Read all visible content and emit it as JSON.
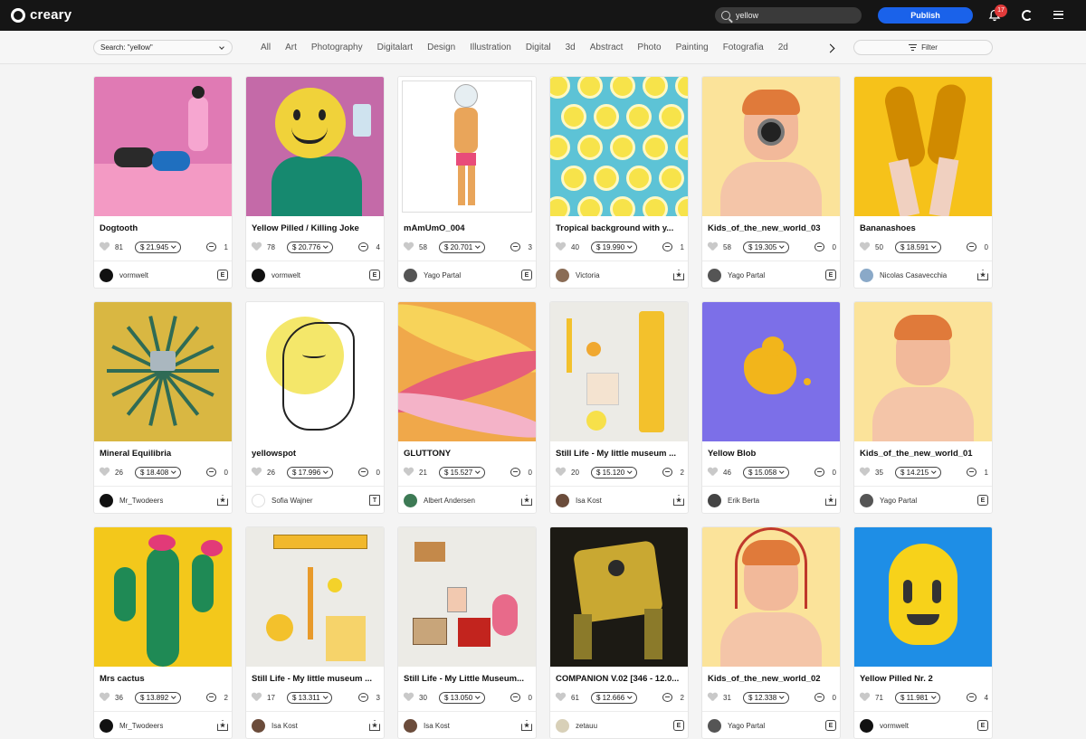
{
  "app": {
    "name": "creary"
  },
  "topbar": {
    "search_value": "yellow",
    "publish_label": "Publish",
    "notification_count": "17"
  },
  "filters": {
    "search_select": "Search: \"yellow\"",
    "filter_label": "Filter",
    "tags": [
      "All",
      "Art",
      "Photography",
      "Digitalart",
      "Design",
      "Illustration",
      "Digital",
      "3d",
      "Abstract",
      "Photo",
      "Painting",
      "Fotografia",
      "2d"
    ]
  },
  "cards": [
    {
      "title": "Dogtooth",
      "likes": "81",
      "price": "$ 21.945",
      "comments": "1",
      "author": "vormwelt",
      "badge": "E",
      "bg": "#e07ab4",
      "accent": "#f4a7c9",
      "avatar": "#111111"
    },
    {
      "title": "Yellow Pilled / Killing Joke",
      "likes": "78",
      "price": "$ 20.776",
      "comments": "4",
      "author": "vormwelt",
      "badge": "E",
      "bg": "#c46aa8",
      "accent": "#f0d23a",
      "avatar": "#111111"
    },
    {
      "title": "mAmUmO_004",
      "likes": "58",
      "price": "$ 20.701",
      "comments": "3",
      "author": "Yago Partal",
      "badge": "E",
      "bg": "#ffffff",
      "accent": "#e9a55a",
      "avatar": "#555555"
    },
    {
      "title": "Tropical background with y...",
      "likes": "40",
      "price": "$ 19.990",
      "comments": "1",
      "author": "Victoria",
      "badge": "H",
      "bg": "#5dc3d6",
      "accent": "#f7e34a",
      "avatar": "#8a6c55"
    },
    {
      "title": "Kids_of_the_new_world_03",
      "likes": "58",
      "price": "$ 19.305",
      "comments": "0",
      "author": "Yago Partal",
      "badge": "E",
      "bg": "#fbe39a",
      "accent": "#f2b99a",
      "avatar": "#555555"
    },
    {
      "title": "Bananashoes",
      "likes": "50",
      "price": "$ 18.591",
      "comments": "0",
      "author": "Nicolas Casavecchia",
      "badge": "H",
      "bg": "#f6c21a",
      "accent": "#e0a800",
      "avatar": "#8aa9c8"
    },
    {
      "title": "Mineral Equilibria",
      "likes": "26",
      "price": "$ 18.408",
      "comments": "0",
      "author": "Mr_Twodeers",
      "badge": "H",
      "bg": "#d9b742",
      "accent": "#2f6b55",
      "avatar": "#111111"
    },
    {
      "title": "yellowspot",
      "likes": "26",
      "price": "$ 17.996",
      "comments": "0",
      "author": "Sofia Wajner",
      "badge": "T",
      "bg": "#ffffff",
      "accent": "#f4e76a",
      "avatar": "#ffffff"
    },
    {
      "title": "GLUTTONY",
      "likes": "21",
      "price": "$ 15.527",
      "comments": "0",
      "author": "Albert Andersen",
      "badge": "H",
      "bg": "#f0a84a",
      "accent": "#e65f7a",
      "avatar": "#3d7a55"
    },
    {
      "title": "Still Life - My little museum ...",
      "likes": "20",
      "price": "$ 15.120",
      "comments": "2",
      "author": "Isa Kost",
      "badge": "H",
      "bg": "#ecebe6",
      "accent": "#f3c12c",
      "avatar": "#6b4c3b"
    },
    {
      "title": "Yellow Blob",
      "likes": "46",
      "price": "$ 15.058",
      "comments": "0",
      "author": "Erik Berta",
      "badge": "H",
      "bg": "#7c6fe8",
      "accent": "#f2b51b",
      "avatar": "#444444"
    },
    {
      "title": "Kids_of_the_new_world_01",
      "likes": "35",
      "price": "$ 14.215",
      "comments": "1",
      "author": "Yago Partal",
      "badge": "E",
      "bg": "#fbe39a",
      "accent": "#f2b99a",
      "avatar": "#555555"
    },
    {
      "title": "Mrs cactus",
      "likes": "36",
      "price": "$ 13.892",
      "comments": "2",
      "author": "Mr_Twodeers",
      "badge": "H",
      "bg": "#f3c81b",
      "accent": "#1f8a55",
      "avatar": "#111111"
    },
    {
      "title": "Still Life - My little museum ...",
      "likes": "17",
      "price": "$ 13.311",
      "comments": "3",
      "author": "Isa Kost",
      "badge": "H",
      "bg": "#ecebe6",
      "accent": "#f3c12c",
      "avatar": "#6b4c3b"
    },
    {
      "title": "Still Life - My Little Museum...",
      "likes": "30",
      "price": "$ 13.050",
      "comments": "0",
      "author": "Isa Kost",
      "badge": "H",
      "bg": "#ecebe6",
      "accent": "#c9a17a",
      "avatar": "#6b4c3b"
    },
    {
      "title": "COMPANION V.02 [346 - 12.0...",
      "likes": "61",
      "price": "$ 12.666",
      "comments": "2",
      "author": "zetauu",
      "badge": "E",
      "bg": "#1c1a14",
      "accent": "#c9a832",
      "avatar": "#d8d0b8"
    },
    {
      "title": "Kids_of_the_new_world_02",
      "likes": "31",
      "price": "$ 12.338",
      "comments": "0",
      "author": "Yago Partal",
      "badge": "E",
      "bg": "#fbe39a",
      "accent": "#f2b99a",
      "avatar": "#555555"
    },
    {
      "title": "Yellow Pilled Nr. 2",
      "likes": "71",
      "price": "$ 11.981",
      "comments": "4",
      "author": "vormwelt",
      "badge": "E",
      "bg": "#1e8ee6",
      "accent": "#f7d21a",
      "avatar": "#111111"
    }
  ]
}
